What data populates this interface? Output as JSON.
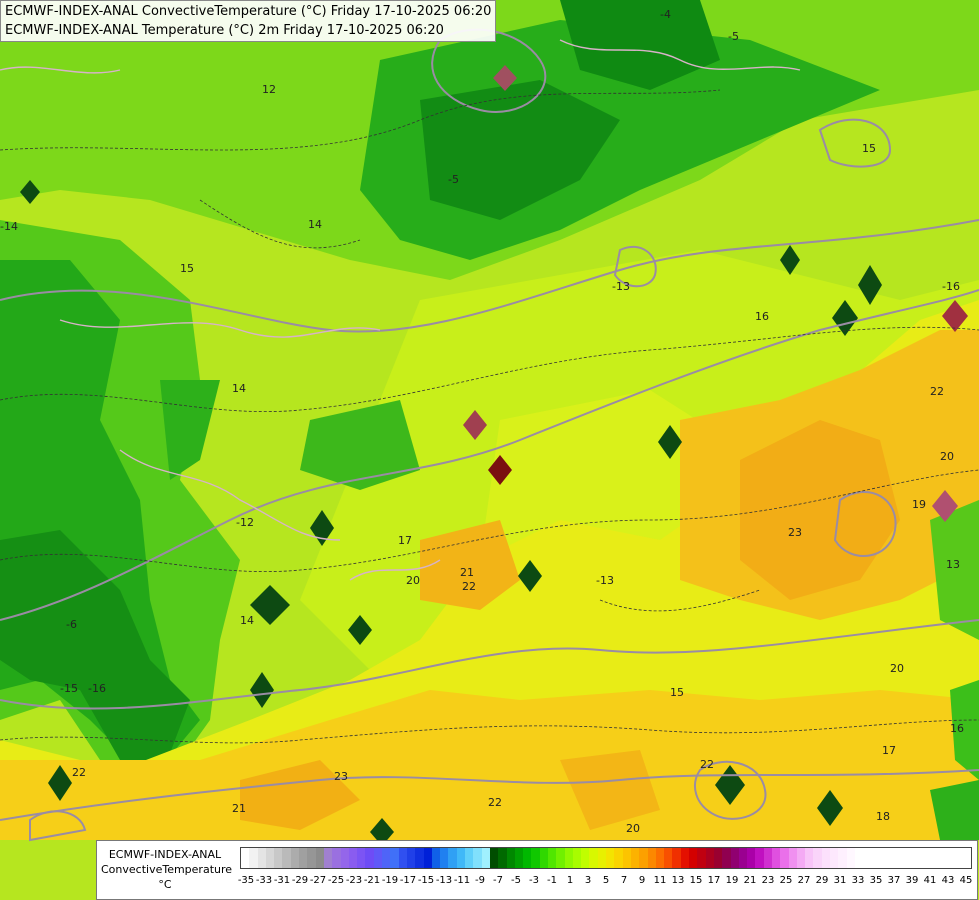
{
  "titles": {
    "line1": "ECMWF-INDEX-ANAL ConvectiveTemperature (°C) Friday 17-10-2025 06:20",
    "line2": "ECMWF-INDEX-ANAL Temperature (°C) 2m Friday 17-10-2025 06:20"
  },
  "legend": {
    "name_line1": "ECMWF-INDEX-ANAL",
    "name_line2": "ConvectiveTemperature",
    "unit": "°C",
    "tick_labels": [
      "-35",
      "-33",
      "-31",
      "-29",
      "-27",
      "-25",
      "-23",
      "-21",
      "-19",
      "-17",
      "-15",
      "-13",
      "-11",
      "-9",
      "-7",
      "-5",
      "-3",
      "-1",
      "1",
      "3",
      "5",
      "7",
      "9",
      "11",
      "13",
      "15",
      "17",
      "19",
      "21",
      "23",
      "25",
      "27",
      "29",
      "31",
      "33",
      "35",
      "37",
      "39",
      "41",
      "43",
      "45"
    ],
    "colors": [
      "#ffffff",
      "#f2f2f2",
      "#e4e4e4",
      "#d6d6d6",
      "#c8c8c8",
      "#bababa",
      "#acacac",
      "#a0a0a0",
      "#969696",
      "#8c8c8c",
      "#a080d0",
      "#9a70e0",
      "#9466ea",
      "#8a5cf0",
      "#7c54f4",
      "#6e4cf6",
      "#6058f8",
      "#4f64f8",
      "#4070f8",
      "#3050f0",
      "#2040e8",
      "#1030e0",
      "#0020d8",
      "#1060e8",
      "#2080f0",
      "#30a0f4",
      "#40b8f8",
      "#60d0fa",
      "#80e0fc",
      "#a0f0fe",
      "#004d00",
      "#006a00",
      "#008800",
      "#00a000",
      "#00b800",
      "#10c800",
      "#30d800",
      "#50e600",
      "#70f000",
      "#90f800",
      "#a8fc00",
      "#c0fe00",
      "#d8f800",
      "#e8f000",
      "#f4e400",
      "#fad400",
      "#fcc400",
      "#fcb200",
      "#fca000",
      "#fc8800",
      "#fc6e00",
      "#f85000",
      "#f03000",
      "#e41000",
      "#d40000",
      "#c00010",
      "#ac0020",
      "#9a0030",
      "#900050",
      "#900070",
      "#9a0090",
      "#aa00a8",
      "#c010c0",
      "#d030d0",
      "#e050e0",
      "#ea70ea",
      "#f090f0",
      "#f4aaf4",
      "#f8c4f8",
      "#fad4fa",
      "#fce0fc",
      "#fde8fd",
      "#fef0fe",
      "#fff8ff",
      "#ffffff",
      "#ffffff",
      "#ffffff",
      "#ffffff",
      "#ffffff",
      "#ffffff",
      "#ffffff",
      "#ffffff",
      "#ffffff",
      "#ffffff",
      "#ffffff",
      "#ffffff",
      "#ffffff",
      "#ffffff"
    ]
  },
  "contour_labels": [
    "12",
    "14",
    "15",
    "-5",
    "-5",
    "-4",
    "15",
    "-13",
    "-16",
    "-14",
    "16",
    "22",
    "20",
    "19",
    "14",
    "-16",
    "14",
    "23",
    "20",
    "21",
    "17",
    "15",
    "22",
    "20",
    "13",
    "21",
    "22",
    "23",
    "22",
    "20",
    "17",
    "16",
    "-15",
    "-6",
    "22",
    "-13",
    "-12",
    "18"
  ],
  "colors": {
    "green_dark": "#0f8c12",
    "green_mid": "#2bb51b",
    "green_light": "#6ad41a",
    "lime": "#a7e21e",
    "yellowgreen": "#c9ef1c",
    "yellow": "#e7ee14",
    "orange_light": "#f6c61a",
    "orange": "#f3a817",
    "contour_grey": "#9a8ca4",
    "border_pink": "#d7b3c8"
  }
}
